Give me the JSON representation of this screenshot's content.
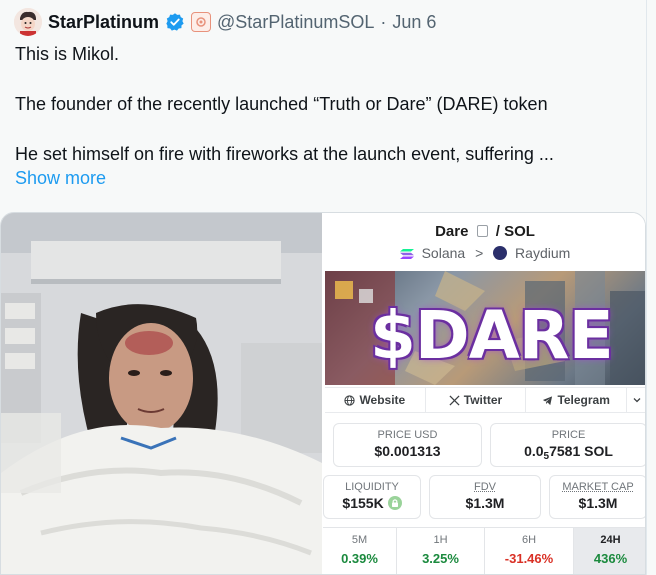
{
  "tweet": {
    "display_name": "StarPlatinum",
    "handle": "@StarPlatinumSOL",
    "separator": "·",
    "date": "Jun 6",
    "lines": [
      "This is Mikol.",
      "The founder of the recently launched “Truth or Dare” (DARE) token",
      "He set himself on fire with fireworks at the launch event, suffering ..."
    ],
    "show_more": "Show more"
  },
  "dex": {
    "pair_base": "Dare",
    "pair_quote": "/ SOL",
    "chain": "Solana",
    "chevron": ">",
    "dex_name": "Raydium",
    "banner_text": "$DARE",
    "links": {
      "website": "Website",
      "twitter": "Twitter",
      "telegram": "Telegram"
    },
    "price_usd_label": "PRICE USD",
    "price_usd": "$0.001313",
    "price_label": "PRICE",
    "price_sol_prefix": "0.0",
    "price_sol_sub": "5",
    "price_sol_rest": "7581 SOL",
    "liquidity_label": "LIQUIDITY",
    "liquidity": "$155K",
    "fdv_label": "FDV",
    "fdv": "$1.3M",
    "mcap_label": "MARKET CAP",
    "mcap": "$1.3M",
    "timeframes": [
      {
        "label": "5M",
        "value": "0.39%"
      },
      {
        "label": "1H",
        "value": "3.25%"
      },
      {
        "label": "6H",
        "value": "-31.46%"
      },
      {
        "label": "24H",
        "value": "436%"
      }
    ],
    "colors": {
      "positive": "#1b8a3e",
      "negative": "#d93025",
      "banner_glow": "#6b2fa0"
    }
  }
}
